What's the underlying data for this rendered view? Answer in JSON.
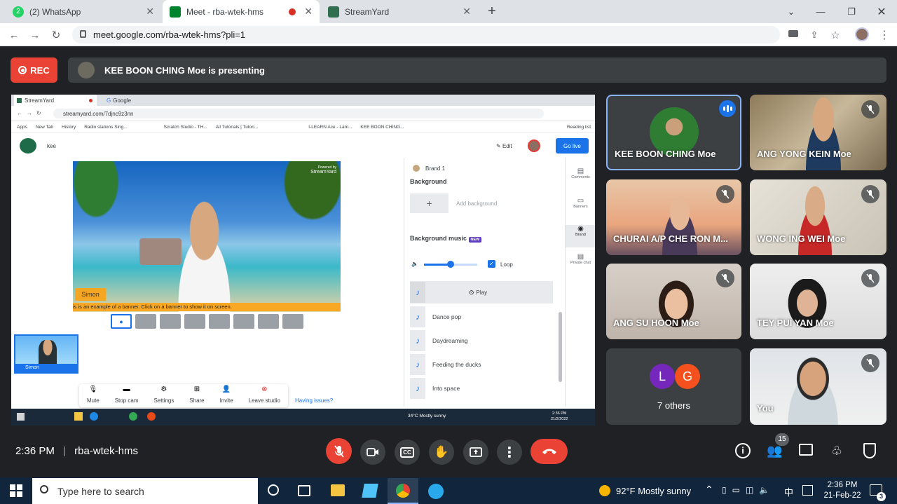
{
  "browser": {
    "tabs": [
      {
        "label": "(2) WhatsApp",
        "icon": "whatsapp-icon",
        "badge": "2"
      },
      {
        "label": "Meet - rba-wtek-hms",
        "icon": "meet-icon"
      },
      {
        "label": "StreamYard",
        "icon": "streamyard-icon"
      }
    ],
    "url": "meet.google.com/rba-wtek-hms?pli=1"
  },
  "meet": {
    "rec_label": "REC",
    "presenting": "KEE BOON CHING Moe is presenting",
    "time": "2:36 PM",
    "divider": "|",
    "meeting_code": "rba-wtek-hms",
    "participant_count": "15",
    "others_label": "7 others",
    "others_avatars": [
      {
        "letter": "L",
        "color": "#7627bb"
      },
      {
        "letter": "G",
        "color": "#f4511e"
      }
    ],
    "participants": [
      {
        "name": "KEE BOON CHING Moe",
        "speaking": true
      },
      {
        "name": "ANG YONG KEIN Moe"
      },
      {
        "name": "CHURAI A/P CHE RON M..."
      },
      {
        "name": "WONG ING WEI Moe"
      },
      {
        "name": "ANG SU HOON Moe"
      },
      {
        "name": "TEY PUI YAN Moe"
      },
      {
        "name": "You"
      }
    ]
  },
  "inner": {
    "tab1": "StreamYard",
    "tab2": "Google",
    "url": "streamyard.com/7djnc9z3nn",
    "bookmarks": [
      "Apps",
      "New Tab",
      "History",
      "Radio stations Sing...",
      "Scratch Studio - TH...",
      "All Tutorials | Tutori...",
      "I-LEARN Ace - Lam...",
      "KEE BOON CHING..."
    ],
    "reading_list": "Reading list",
    "studio_name": "kee",
    "edit": "Edit",
    "go_live": "Go live",
    "simon": "Simon",
    "banner": "is is an example of a banner. Click on a banner to show it on screen.",
    "powered": "Powered by",
    "watermark": "StreamYard",
    "thumb_name": "Simon",
    "brand": "Brand 1",
    "background": "Background",
    "add_background": "Add background",
    "bg_music": "Background music",
    "new_badge": "NEW",
    "loop": "Loop",
    "play": "Play",
    "tracks": [
      "Dance pop",
      "Daydreaming",
      "Feeding the ducks",
      "Into space"
    ],
    "side": [
      "Comments",
      "Banners",
      "Brand",
      "Private chat"
    ],
    "controls": [
      "Mute",
      "Stop cam",
      "Settings",
      "Share",
      "Invite",
      "Leave studio"
    ],
    "having_issues": "Having issues?",
    "weather": "34°C  Mostly sunny",
    "clock": "2:36 PM",
    "date": "21/2/2022"
  },
  "taskbar": {
    "search_placeholder": "Type here to search",
    "weather": "92°F  Mostly sunny",
    "time": "2:36 PM",
    "date": "21-Feb-22",
    "lang": "中",
    "notif": "3"
  }
}
